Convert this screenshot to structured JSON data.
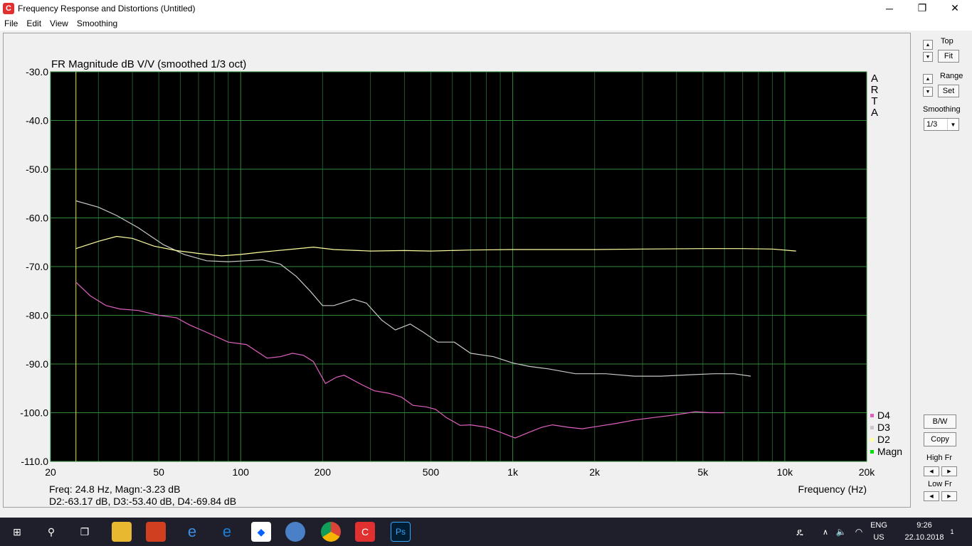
{
  "window": {
    "title": "Frequency Response and Distortions (Untitled)",
    "minimize": "─",
    "maximize": "❐",
    "close": "✕"
  },
  "menu": [
    "File",
    "Edit",
    "View",
    "Smoothing"
  ],
  "chart_data": {
    "type": "line",
    "title": "FR Magnitude dB V/V (smoothed 1/3 oct)",
    "xlabel": "Frequency (Hz)",
    "ylabel": "",
    "x_scale": "log",
    "xlim": [
      20,
      20000
    ],
    "ylim": [
      -110,
      -30
    ],
    "x_ticks": [
      {
        "value": 20,
        "label": "20"
      },
      {
        "value": 50,
        "label": "50"
      },
      {
        "value": 100,
        "label": "100"
      },
      {
        "value": 200,
        "label": "200"
      },
      {
        "value": 500,
        "label": "500"
      },
      {
        "value": 1000,
        "label": "1k"
      },
      {
        "value": 2000,
        "label": "2k"
      },
      {
        "value": 5000,
        "label": "5k"
      },
      {
        "value": 10000,
        "label": "10k"
      },
      {
        "value": 20000,
        "label": "20k"
      }
    ],
    "y_ticks": [
      {
        "value": -30,
        "label": "-30.0"
      },
      {
        "value": -40,
        "label": "-40.0"
      },
      {
        "value": -50,
        "label": "-50.0"
      },
      {
        "value": -60,
        "label": "-60.0"
      },
      {
        "value": -70,
        "label": "-70.0"
      },
      {
        "value": -80,
        "label": "-80.0"
      },
      {
        "value": -90,
        "label": "-90.0"
      },
      {
        "value": -100,
        "label": "-100.0"
      },
      {
        "value": -110,
        "label": "-110.0"
      }
    ],
    "grid": true,
    "cursor_freq": 24.8,
    "watermark": "ARTA",
    "legend_position": "bottom-right",
    "series": [
      {
        "name": "D4",
        "color": "#e060c0",
        "points": [
          [
            24.8,
            -73.2
          ],
          [
            28,
            -76
          ],
          [
            32,
            -78
          ],
          [
            36,
            -78.7
          ],
          [
            42,
            -79
          ],
          [
            50,
            -80
          ],
          [
            58,
            -80.5
          ],
          [
            65,
            -82
          ],
          [
            75,
            -83.5
          ],
          [
            90,
            -85.5
          ],
          [
            105,
            -86
          ],
          [
            125,
            -88.8
          ],
          [
            140,
            -88.5
          ],
          [
            155,
            -87.8
          ],
          [
            170,
            -88.2
          ],
          [
            185,
            -89.5
          ],
          [
            205,
            -94
          ],
          [
            225,
            -92.7
          ],
          [
            240,
            -92.3
          ],
          [
            280,
            -94.3
          ],
          [
            310,
            -95.5
          ],
          [
            350,
            -96
          ],
          [
            390,
            -96.8
          ],
          [
            430,
            -98.5
          ],
          [
            480,
            -98.8
          ],
          [
            520,
            -99.3
          ],
          [
            570,
            -101
          ],
          [
            640,
            -102.6
          ],
          [
            700,
            -102.5
          ],
          [
            800,
            -103
          ],
          [
            900,
            -104
          ],
          [
            1020,
            -105.2
          ],
          [
            1150,
            -104
          ],
          [
            1280,
            -103
          ],
          [
            1400,
            -102.5
          ],
          [
            1600,
            -103
          ],
          [
            1800,
            -103.3
          ],
          [
            2050,
            -102.8
          ],
          [
            2400,
            -102.2
          ],
          [
            2800,
            -101.5
          ],
          [
            3300,
            -101
          ],
          [
            3900,
            -100.5
          ],
          [
            4700,
            -99.8
          ],
          [
            5300,
            -100
          ],
          [
            6000,
            -100
          ]
        ]
      },
      {
        "name": "D3",
        "color": "#c8c8c8",
        "points": [
          [
            24.8,
            -56.5
          ],
          [
            30,
            -57.8
          ],
          [
            35,
            -59.5
          ],
          [
            42,
            -62
          ],
          [
            52,
            -65.5
          ],
          [
            62,
            -67.5
          ],
          [
            75,
            -68.8
          ],
          [
            90,
            -69
          ],
          [
            105,
            -68.8
          ],
          [
            120,
            -68.6
          ],
          [
            140,
            -69.5
          ],
          [
            160,
            -72
          ],
          [
            180,
            -75
          ],
          [
            200,
            -78
          ],
          [
            220,
            -78
          ],
          [
            260,
            -76.7
          ],
          [
            290,
            -77.5
          ],
          [
            330,
            -81
          ],
          [
            370,
            -83
          ],
          [
            420,
            -81.8
          ],
          [
            470,
            -83.5
          ],
          [
            530,
            -85.5
          ],
          [
            610,
            -85.5
          ],
          [
            700,
            -87.8
          ],
          [
            850,
            -88.5
          ],
          [
            1000,
            -89.8
          ],
          [
            1150,
            -90.5
          ],
          [
            1350,
            -91
          ],
          [
            1700,
            -92
          ],
          [
            2200,
            -92
          ],
          [
            2800,
            -92.5
          ],
          [
            3500,
            -92.5
          ],
          [
            4500,
            -92.2
          ],
          [
            5500,
            -92
          ],
          [
            6500,
            -92
          ],
          [
            7500,
            -92.5
          ]
        ]
      },
      {
        "name": "D2",
        "color": "#ffffa0",
        "points": [
          [
            24.8,
            -66.3
          ],
          [
            30,
            -64.8
          ],
          [
            35,
            -63.8
          ],
          [
            40,
            -64.2
          ],
          [
            48,
            -65.8
          ],
          [
            58,
            -66.7
          ],
          [
            70,
            -67.3
          ],
          [
            85,
            -67.8
          ],
          [
            100,
            -67.5
          ],
          [
            120,
            -67
          ],
          [
            150,
            -66.5
          ],
          [
            185,
            -66
          ],
          [
            220,
            -66.5
          ],
          [
            300,
            -66.8
          ],
          [
            400,
            -66.7
          ],
          [
            500,
            -66.8
          ],
          [
            700,
            -66.6
          ],
          [
            1000,
            -66.5
          ],
          [
            2000,
            -66.5
          ],
          [
            3000,
            -66.4
          ],
          [
            5000,
            -66.3
          ],
          [
            7000,
            -66.3
          ],
          [
            9000,
            -66.4
          ],
          [
            11000,
            -66.8
          ]
        ]
      },
      {
        "name": "Magn",
        "color": "#00e000",
        "points": []
      }
    ]
  },
  "readout": {
    "line1": "Freq: 24.8 Hz, Magn:-3.23 dB",
    "line2": "D2:-63.17 dB, D3:-53.40 dB, D4:-69.84 dB"
  },
  "panel": {
    "top_label": "Top",
    "fit_button": "Fit",
    "range_label": "Range",
    "set_button": "Set",
    "smoothing_label": "Smoothing",
    "smoothing_value": "1/3",
    "bw_button": "B/W",
    "copy_button": "Copy",
    "high_fr_label": "High Fr",
    "low_fr_label": "Low Fr"
  },
  "taskbar": {
    "lang": "ENG",
    "region": "US",
    "time": "9:26",
    "date": "22.10.2018",
    "notifications": "1"
  }
}
